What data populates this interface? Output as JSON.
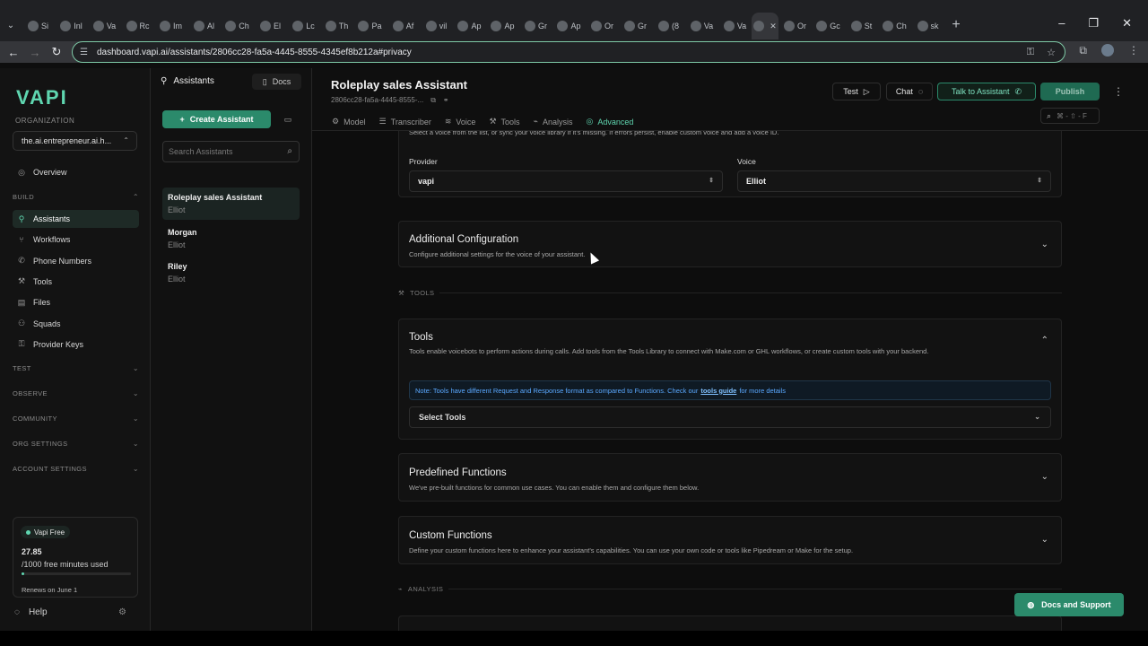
{
  "browser": {
    "tabs": [
      "Si",
      "Inl",
      "Va",
      "Rc",
      "Im",
      "Al",
      "Ch",
      "El",
      "Lc",
      "Th",
      "Pa",
      "Af",
      "vil",
      "Ap",
      "Ap",
      "Gr",
      "Ap",
      "Or",
      "Gr",
      "(8",
      "Va",
      "Va",
      "",
      "Or",
      "Gc",
      "St",
      "Ch",
      "sk"
    ],
    "active_tab_index": 22,
    "url": "dashboard.vapi.ai/assistants/2806cc28-fa5a-4445-8555-4345ef8b212a#privacy"
  },
  "sidebar": {
    "logo": "VAPI",
    "org_label": "ORGANIZATION",
    "org_name": "the.ai.entrepreneur.ai.h...",
    "overview": "Overview",
    "build_label": "BUILD",
    "items": [
      {
        "label": "Assistants",
        "icon": "user-icon",
        "active": true
      },
      {
        "label": "Workflows",
        "icon": "workflow-icon"
      },
      {
        "label": "Phone Numbers",
        "icon": "phone-icon"
      },
      {
        "label": "Tools",
        "icon": "wrench-icon"
      },
      {
        "label": "Files",
        "icon": "file-icon"
      },
      {
        "label": "Squads",
        "icon": "users-icon"
      },
      {
        "label": "Provider Keys",
        "icon": "key-icon"
      }
    ],
    "sections": [
      "TEST",
      "OBSERVE",
      "COMMUNITY",
      "ORG SETTINGS",
      "ACCOUNT SETTINGS"
    ],
    "plan": {
      "badge": "Vapi Free",
      "minutes": "27.85",
      "minutes_sub": "/1000 free minutes used",
      "usage_fraction": 0.028,
      "renews": "Renews on June 1"
    },
    "help": "Help"
  },
  "assistants": {
    "header": "Assistants",
    "docs": "Docs",
    "create": "Create Assistant",
    "search_placeholder": "Search Assistants",
    "list": [
      {
        "name": "Roleplay sales Assistant",
        "voice": "Elliot",
        "active": true
      },
      {
        "name": "Morgan",
        "voice": "Elliot"
      },
      {
        "name": "Riley",
        "voice": "Elliot"
      }
    ]
  },
  "main": {
    "title": "Roleplay sales Assistant",
    "id": "2806cc28-fa5a-4445-8555-...",
    "tabs": [
      "Model",
      "Transcriber",
      "Voice",
      "Tools",
      "Analysis",
      "Advanced"
    ],
    "active_tab": "Advanced",
    "buttons": {
      "test": "Test",
      "chat": "Chat",
      "talk": "Talk to Assistant",
      "publish": "Publish"
    },
    "shortcut": "⌘ - ⇧ - F",
    "voice_note": "Select a voice from the list, or sync your voice library if it's missing. If errors persist, enable custom voice and add a voice ID.",
    "provider_label": "Provider",
    "provider_value": "vapi",
    "voice_label": "Voice",
    "voice_value": "Elliot",
    "additional_config": {
      "title": "Additional Configuration",
      "desc": "Configure additional settings for the voice of your assistant."
    },
    "tools_divider": "TOOLS",
    "tools_card": {
      "title": "Tools",
      "desc": "Tools enable voicebots to perform actions during calls. Add tools from the Tools Library to connect with Make.com or GHL workflows, or create custom tools with your backend.",
      "note_pre": "Note: Tools have different Request and Response format as compared to Functions. Check our",
      "note_link": "tools guide",
      "note_post": "for more details",
      "select_placeholder": "Select Tools"
    },
    "predefined": {
      "title": "Predefined Functions",
      "desc": "We've pre-built functions for common use cases. You can enable them and configure them below."
    },
    "custom": {
      "title": "Custom Functions",
      "desc": "Define your custom functions here to enhance your assistant's capabilities. You can use your own code or tools like Pipedream or Make for the setup."
    },
    "analysis_divider": "ANALYSIS",
    "docs_support": "Docs and Support"
  },
  "colors": {
    "accent": "#5fd6b0",
    "button": "#2b8a6b",
    "link": "#5aa8ff"
  }
}
